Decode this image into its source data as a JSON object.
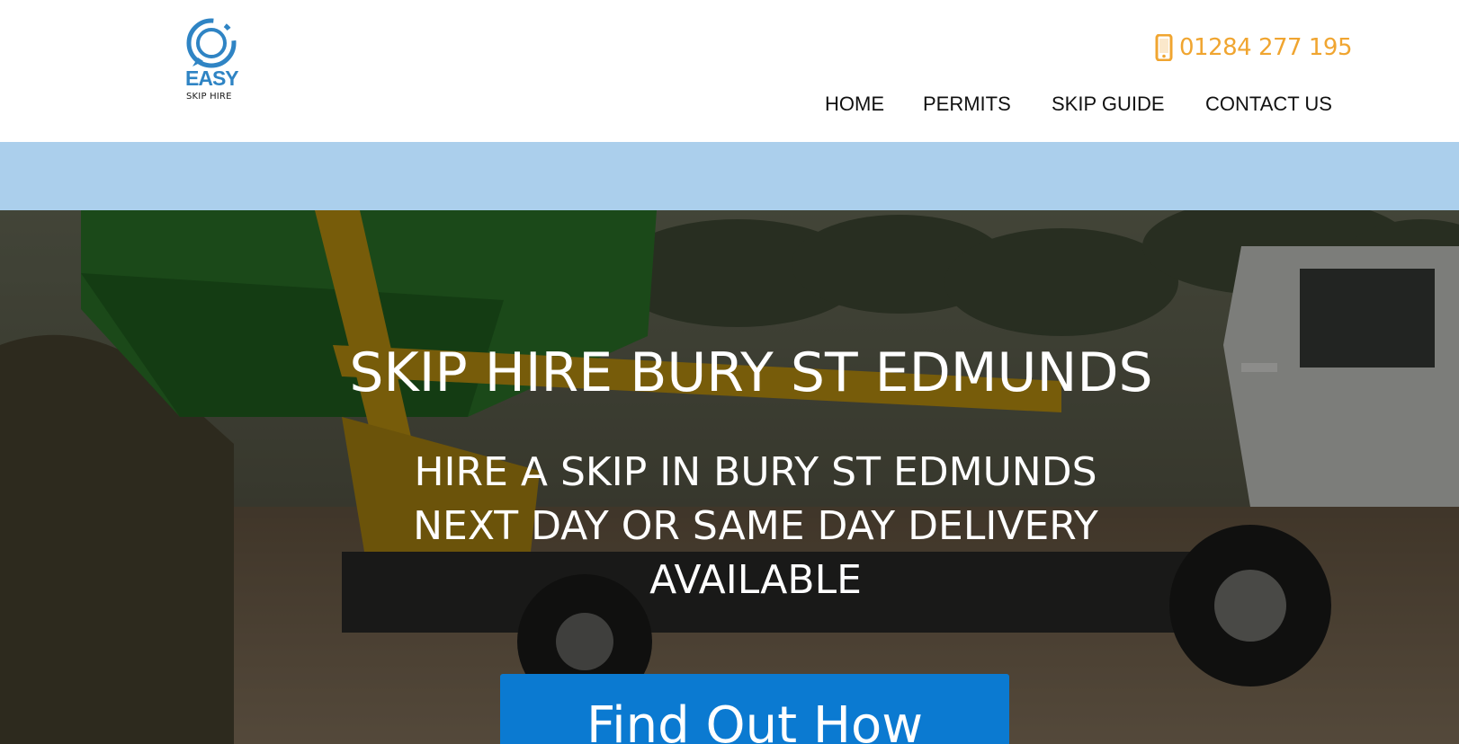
{
  "brand": {
    "logo_word": "EASY",
    "logo_sub": "SKIP HIRE",
    "colors": {
      "logo_blue": "#2f84c4",
      "phone_orange": "#f0a530",
      "band_blue": "#abcfec",
      "cta_blue": "#0b7ad1"
    }
  },
  "header": {
    "phone": {
      "icon": "mobile-phone-icon",
      "number": "01284 277 195"
    },
    "nav": [
      {
        "label": "HOME"
      },
      {
        "label": "PERMITS"
      },
      {
        "label": "SKIP GUIDE"
      },
      {
        "label": "CONTACT US"
      }
    ]
  },
  "hero": {
    "title": "SKIP HIRE BURY ST EDMUNDS",
    "subtitle_lines": [
      "HIRE A SKIP IN BURY ST EDMUNDS",
      "NEXT DAY OR SAME DAY DELIVERY",
      "AVAILABLE"
    ],
    "cta_label": "Find Out How"
  }
}
